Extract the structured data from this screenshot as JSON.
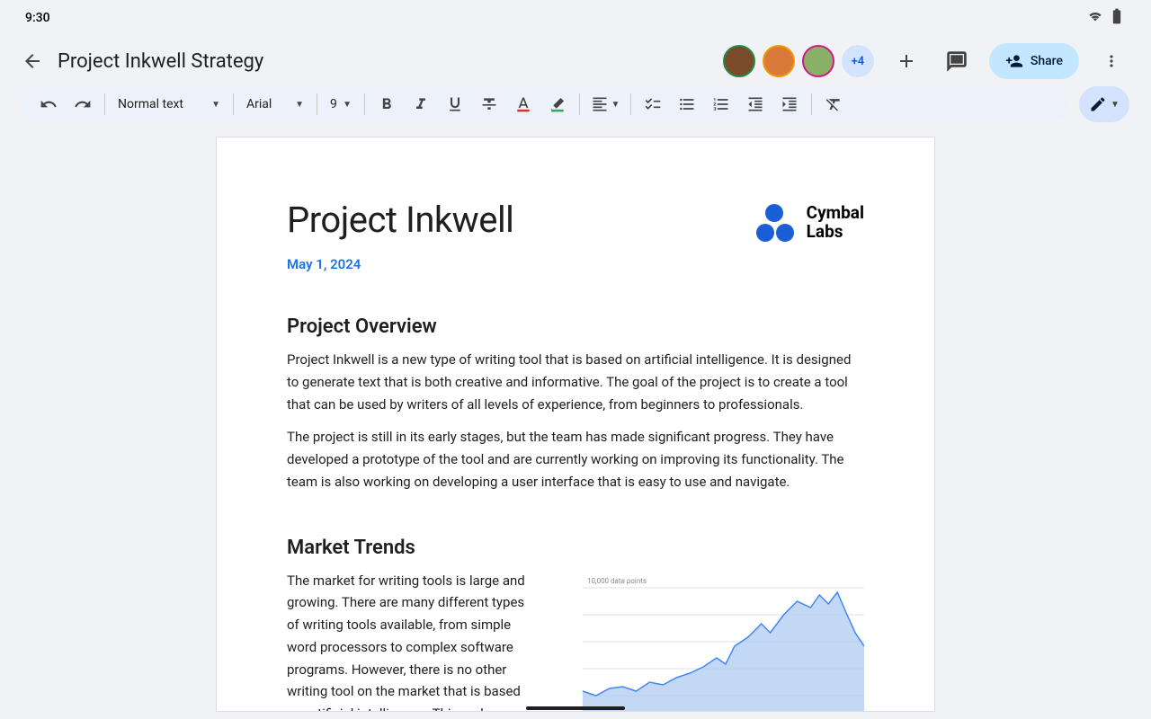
{
  "status": {
    "time": "9:30"
  },
  "header": {
    "title": "Project Inkwell Strategy",
    "more_count": "+4",
    "share_label": "Share"
  },
  "toolbar": {
    "style": "Normal text",
    "font": "Arial",
    "size": "9"
  },
  "document": {
    "title": "Project Inkwell",
    "logo_name": "Cymbal\nLabs",
    "date": "May 1, 2024",
    "sections": [
      {
        "heading": "Project Overview",
        "paragraphs": [
          "Project Inkwell is a new type of writing tool that is based on artificial intelligence. It is designed to generate text that is both creative and informative. The goal of the project is to create a tool that can be used by writers of all levels of experience, from beginners to professionals.",
          "The project is still in its early stages, but the team has made significant progress. They have developed a prototype of the tool and are currently working on improving its functionality. The team is also working on developing a user interface that is easy to use and navigate."
        ]
      },
      {
        "heading": "Market Trends",
        "paragraphs": [
          "The market for writing tools is large and growing. There are many different types of writing tools available, from simple word processors to complex software programs. However, there is no other writing tool on the market that is based on artificial intelligence. This makes"
        ]
      }
    ]
  },
  "chart_data": {
    "type": "area",
    "title": "10,000 data points",
    "xlabel": "",
    "ylabel": "",
    "ylim": [
      10000,
      30000
    ],
    "x": [
      0,
      10,
      20,
      30,
      40,
      50,
      60,
      70,
      80,
      85,
      90,
      95,
      100
    ],
    "values": [
      12000,
      11500,
      13000,
      12500,
      14000,
      15500,
      18000,
      22000,
      25000,
      28000,
      27000,
      29000,
      24000
    ]
  }
}
